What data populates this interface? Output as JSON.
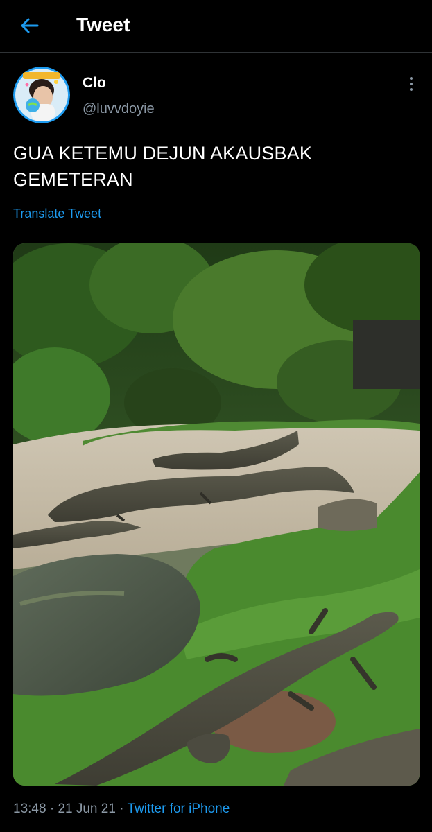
{
  "header": {
    "back_icon": "arrow-left-icon",
    "title": "Tweet"
  },
  "tweet": {
    "author": {
      "display_name": "Clo",
      "handle": "@luvvdoyie",
      "avatar_icon": "avatar"
    },
    "more_icon": "more-vertical-icon",
    "text_line1": "GUA KETEMU DEJUN AKAUSBAK",
    "text_line2": "GEMETERAN",
    "translate_label": "Translate Tweet",
    "media": {
      "description_icon": "photo"
    },
    "time": "13:48",
    "separator": "·",
    "date": "21 Jun 21",
    "source": "Twitter for iPhone"
  },
  "colors": {
    "background": "#000000",
    "accent": "#1d9bf0",
    "secondary_text": "#8b98a5",
    "divider": "#2f3336"
  }
}
